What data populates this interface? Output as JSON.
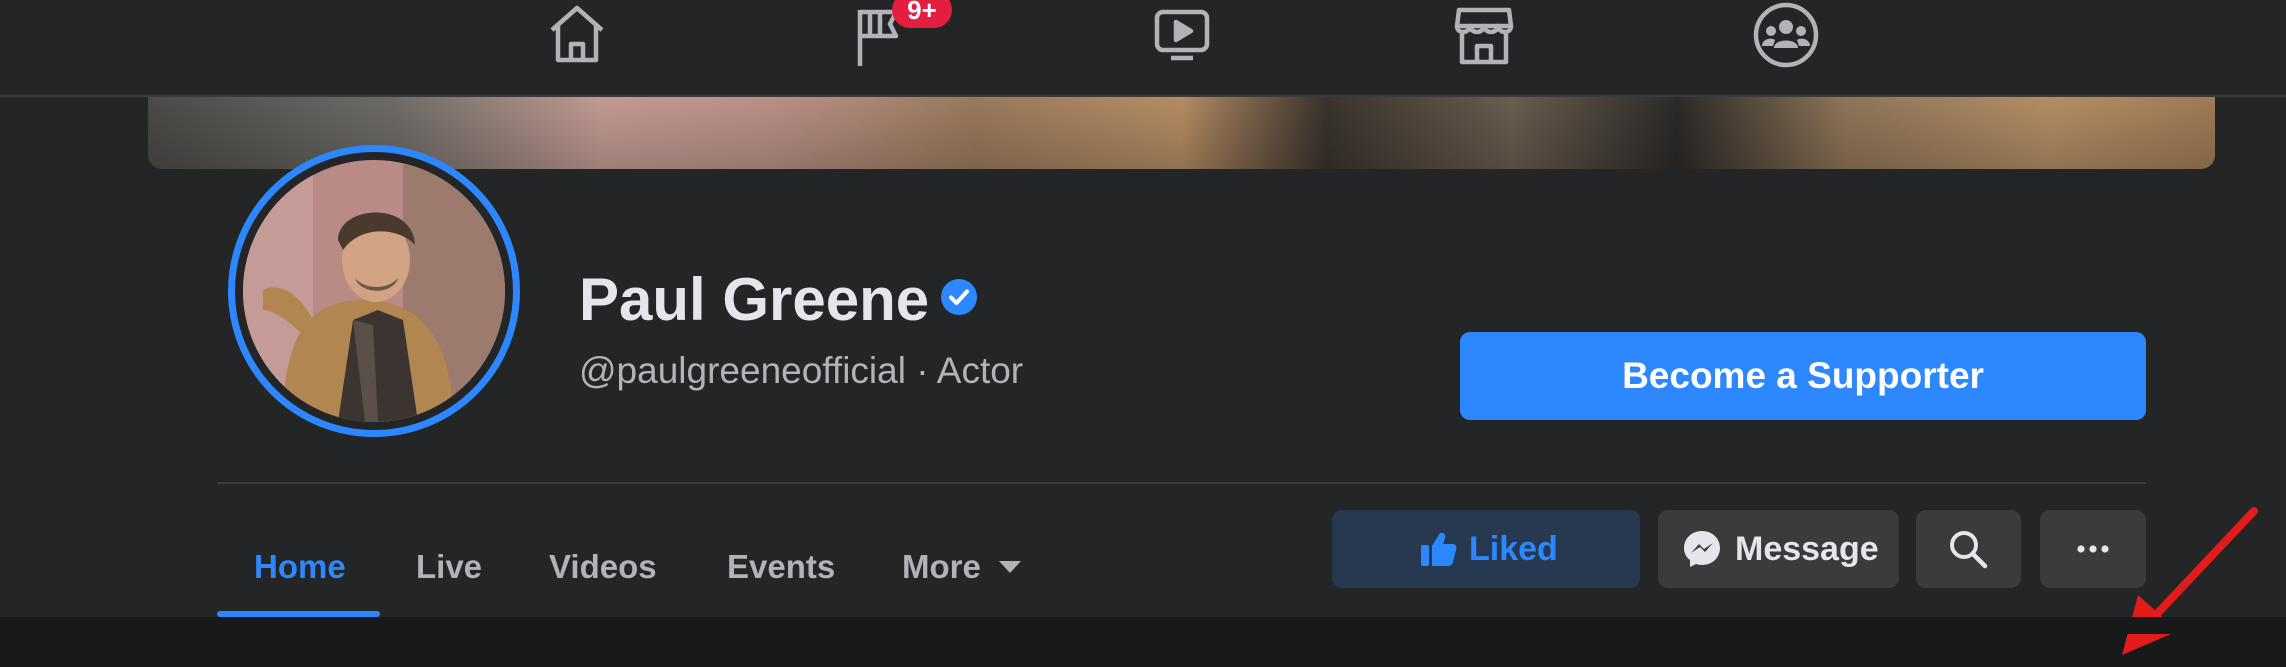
{
  "topnav": {
    "icons": [
      "home-icon",
      "pages-flag-icon",
      "watch-icon",
      "marketplace-icon",
      "groups-icon"
    ],
    "pages_badge": "9+"
  },
  "profile": {
    "name": "Paul Greene",
    "handle_line": "@paulgreeneofficial · Actor",
    "verified": true,
    "support_button": "Become a Supporter"
  },
  "tabs": [
    {
      "label": "Home",
      "active": true
    },
    {
      "label": "Live",
      "active": false
    },
    {
      "label": "Videos",
      "active": false
    },
    {
      "label": "Events",
      "active": false
    },
    {
      "label": "More",
      "active": false
    }
  ],
  "actions": {
    "liked_label": "Liked",
    "message_label": "Message",
    "search_icon": "search-icon",
    "more_icon": "more-dots-icon"
  },
  "colors": {
    "accent": "#2d88ff",
    "background": "#242526",
    "badge": "#e41e3f",
    "annotation_arrow": "#e41b1b"
  }
}
